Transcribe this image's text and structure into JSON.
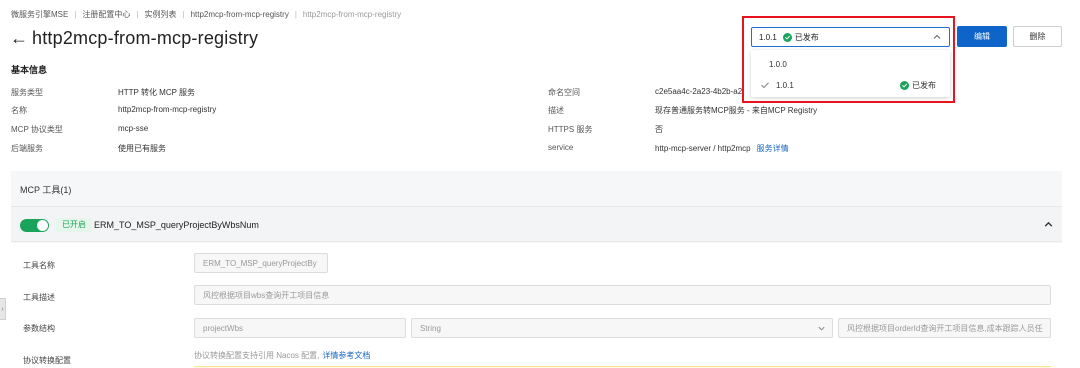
{
  "breadcrumb": [
    {
      "label": "微服务引擎MSE"
    },
    {
      "label": "注册配置中心"
    },
    {
      "label": "实例列表"
    },
    {
      "label": "http2mcp-from-mcp-registry"
    },
    {
      "label": "http2mcp-from-mcp-registry"
    }
  ],
  "header": {
    "back_icon": "arrow-left-icon",
    "title": "http2mcp-from-mcp-registry"
  },
  "version_select": {
    "selected_version": "1.0.1",
    "selected_status": "已发布",
    "options": [
      {
        "version": "1.0.0",
        "status": ""
      },
      {
        "version": "1.0.1",
        "status": "已发布",
        "selected": true
      }
    ]
  },
  "actions": {
    "edit": "编辑",
    "delete": "删除"
  },
  "basic_info": {
    "title": "基本信息",
    "rows": [
      {
        "label": "服务类型",
        "value": "HTTP 转化 MCP 服务"
      },
      {
        "label": "名称",
        "value": "http2mcp-from-mcp-registry"
      },
      {
        "label": "MCP 协议类型",
        "value": "mcp-sse"
      },
      {
        "label": "后端服务",
        "value": "使用已有服务"
      },
      {
        "label": "命名空间",
        "value": "c2e5aa4c-2a23-4b2b-a2"
      },
      {
        "label": "描述",
        "value": "现存普通服务转MCP服务 - 来自MCP Registry"
      },
      {
        "label": "HTTPS 服务",
        "value": "否"
      },
      {
        "label": "service",
        "value": "http-mcp-server / http2mcp",
        "link": "服务详情"
      }
    ]
  },
  "mcp_tools": {
    "header": "MCP 工具(1)",
    "tool": {
      "toggle_on": true,
      "status": "已开启",
      "name": "ERM_TO_MSP_queryProjectByWbsNum",
      "form": {
        "name_label": "工具名称",
        "name_value": "ERM_TO_MSP_queryProjectBy",
        "desc_label": "工具描述",
        "desc_value": "风控根据项目wbs查询开工项目信息",
        "params_label": "参数结构",
        "param_name": "projectWbs",
        "param_type": "String",
        "param_desc": "风控根据项目orderId查询开工项目信息,成本跟踪人员任",
        "protocol_label": "协议转换配置",
        "protocol_hint": "协议转换配置支持引用 Nacos 配置,",
        "protocol_link": "详情参考文档"
      }
    }
  },
  "colors": {
    "primary": "#0f64c9",
    "success": "#1aa35a",
    "highlight": "#e8131e",
    "link": "#1565c0"
  }
}
